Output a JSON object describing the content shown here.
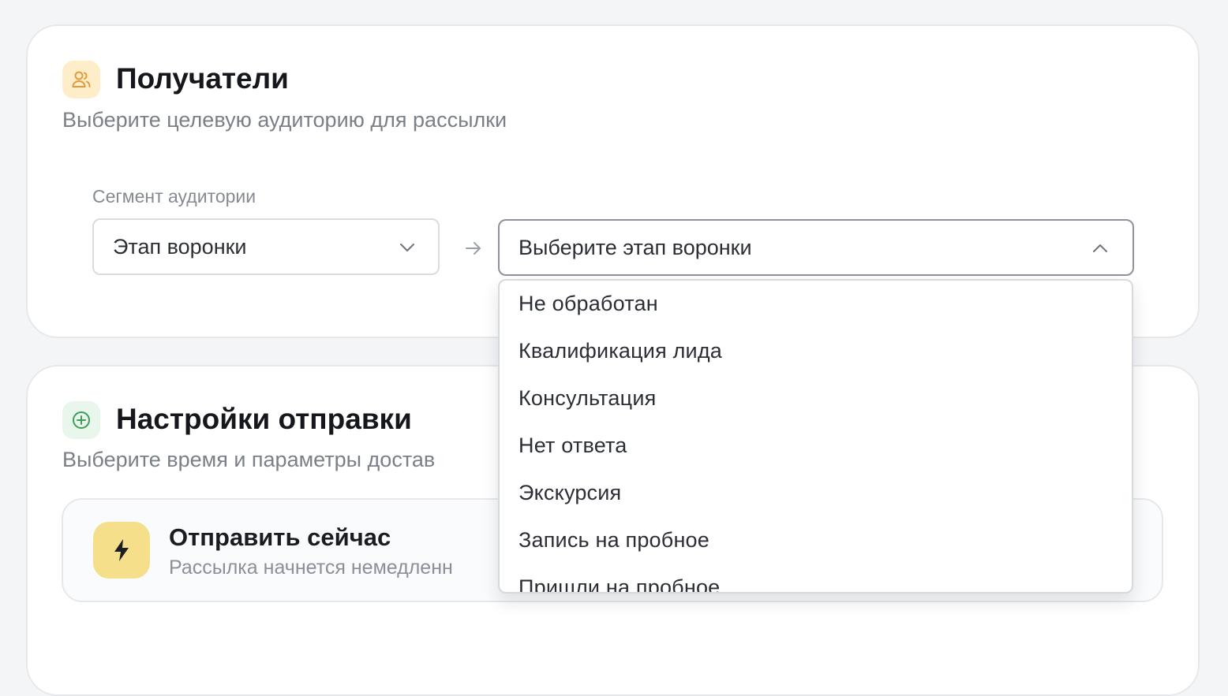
{
  "recipients": {
    "title": "Получатели",
    "subtitle": "Выберите целевую аудиторию для рассылки",
    "segment_label": "Сегмент аудитории",
    "segment_value": "Этап воронки",
    "stage_placeholder": "Выберите этап воронки",
    "stage_options": [
      "Не обработан",
      "Квалификация лида",
      "Консультация",
      "Нет ответа",
      "Экскурсия",
      "Запись на пробное",
      "Пришли на пробное"
    ]
  },
  "settings": {
    "title": "Настройки отправки",
    "subtitle": "Выберите время и параметры достав",
    "send_now_title": "Отправить сейчас",
    "send_now_sub": "Рассылка начнется немедленн"
  },
  "icons": {
    "recipients": "users-icon",
    "settings": "plus-circle-icon",
    "send_now": "lightning-bolt-icon",
    "chevron_down": "chevron-down-icon",
    "chevron_up": "chevron-up-icon",
    "arrow": "arrow-right-icon"
  },
  "colors": {
    "recipients_badge": "#fdeec9",
    "recipients_icon": "#e59a3a",
    "settings_badge": "#e9f6ec",
    "settings_icon": "#3f9d5c",
    "send_badge": "#f6df8a"
  }
}
